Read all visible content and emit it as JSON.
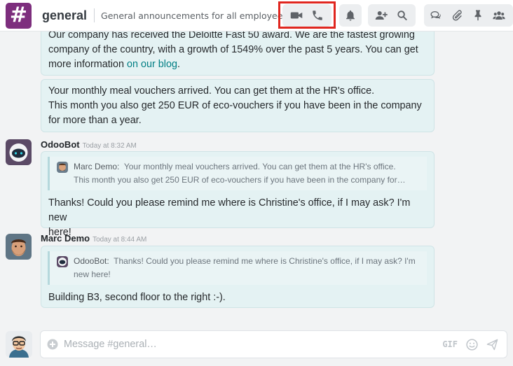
{
  "header": {
    "channel_symbol": "#",
    "channel_name": "general",
    "description": "General announcements for all employees.",
    "icons": [
      "video-camera-icon",
      "phone-icon",
      "bell-icon",
      "add-user-icon",
      "search-icon",
      "threads-icon",
      "attachment-icon",
      "pin-icon",
      "members-icon"
    ],
    "highlight_color": "#e0261f"
  },
  "messages": {
    "first": {
      "line1": "Our company has received the Deloitte Fast 50 award. We are the fastest growing",
      "line2": "company of the country, with a growth of 1549% over the past 5 years. You can get",
      "line3_prefix": "more information ",
      "link": "on our blog",
      "line3_suffix": "."
    },
    "second": {
      "line1": "Your monthly meal vouchers arrived. You can get them at the HR's office.",
      "line2": "This month you also get 250 EUR of eco-vouchers if you have been in the company",
      "line3": "for more than a year."
    },
    "odoobot": {
      "author": "OdooBot",
      "time": "Today at 8:32 AM",
      "quote_author": "Marc Demo",
      "quote_sep": ":",
      "quote_line1": "Your monthly meal vouchers arrived. You can get them at the HR's office.",
      "quote_line2": "This month you also get 250 EUR of eco-vouchers if you have been in the company for…",
      "line1": "Thanks! Could you please remind me where is Christine's office, if I may ask? I'm new",
      "line2": "here!"
    },
    "marc": {
      "author": "Marc Demo",
      "time": "Today at 8:44 AM",
      "quote_author": "OdooBot",
      "quote_sep": ":",
      "quote_line1": "Thanks! Could you please remind me where is Christine's office, if I may ask? I'm",
      "quote_line2": "new here!",
      "line1": "Building B3, second floor to the right :-)."
    }
  },
  "composer": {
    "placeholder": "Message #general…",
    "gif_label": "GIF"
  },
  "colors": {
    "channel": "#7d2e7d",
    "bubble": "#e4f2f3",
    "link": "#017e84"
  }
}
